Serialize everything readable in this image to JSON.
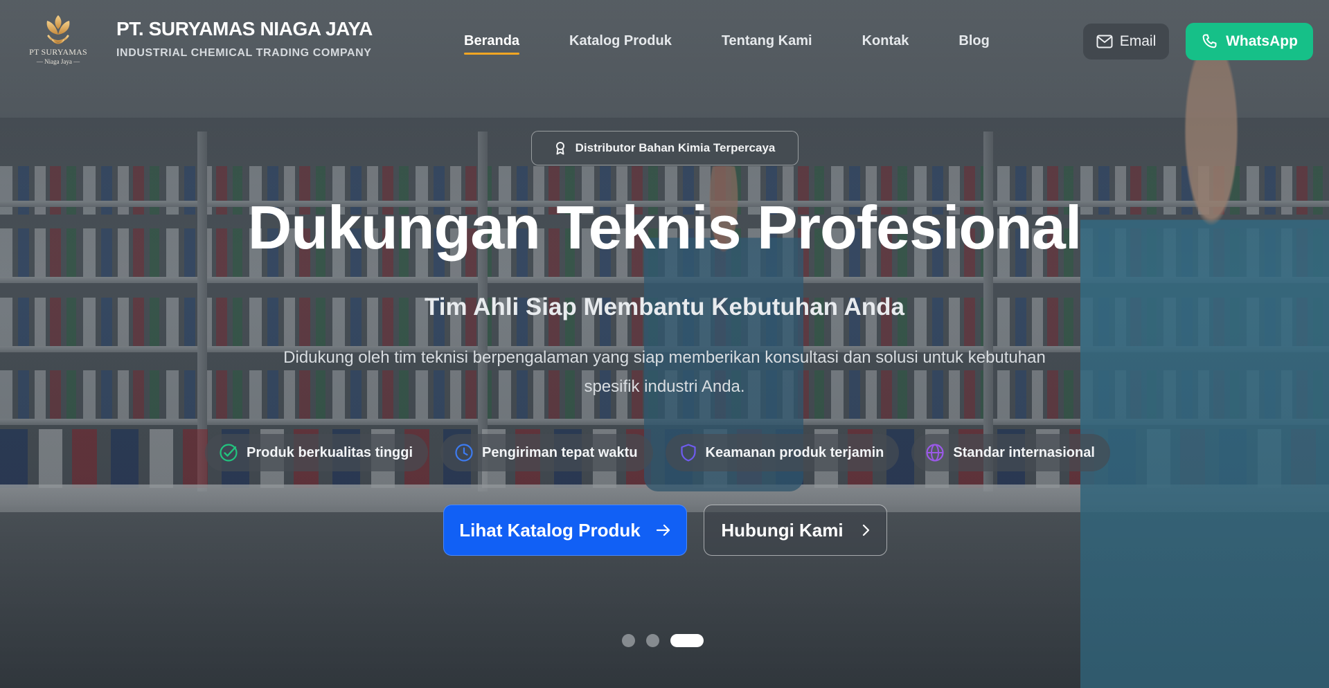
{
  "brand": {
    "logo_line1": "PT SURYAMAS",
    "logo_line2": "— Niaga Jaya —",
    "name": "PT. SURYAMAS NIAGA JAYA",
    "tagline": "INDUSTRIAL CHEMICAL TRADING COMPANY"
  },
  "nav": {
    "items": [
      {
        "label": "Beranda",
        "active": true
      },
      {
        "label": "Katalog Produk",
        "active": false
      },
      {
        "label": "Tentang Kami",
        "active": false
      },
      {
        "label": "Kontak",
        "active": false
      },
      {
        "label": "Blog",
        "active": false
      }
    ]
  },
  "header_actions": {
    "email_label": "Email",
    "whatsapp_label": "WhatsApp"
  },
  "hero": {
    "badge": "Distributor Bahan Kimia Terpercaya",
    "title": "Dukungan Teknis Profesional",
    "subtitle": "Tim Ahli Siap Membantu Kebutuhan Anda",
    "description": "Didukung oleh tim teknisi berpengalaman yang siap memberikan konsultasi dan solusi untuk kebutuhan spesifik industri Anda.",
    "features": [
      {
        "label": "Produk berkualitas tinggi",
        "icon": "check-circle-icon",
        "color": "#22c47f"
      },
      {
        "label": "Pengiriman tepat waktu",
        "icon": "clock-icon",
        "color": "#3d7bf0"
      },
      {
        "label": "Keamanan produk terjamin",
        "icon": "shield-icon",
        "color": "#6f5cf0"
      },
      {
        "label": "Standar internasional",
        "icon": "globe-icon",
        "color": "#9b59e8"
      }
    ],
    "cta_primary": "Lihat Katalog Produk",
    "cta_secondary": "Hubungi Kami"
  },
  "carousel": {
    "slide_count": 3,
    "active_index": 2
  },
  "colors": {
    "accent_underline": "#f5a623",
    "whatsapp": "#16c088",
    "primary_cta": "#1160f5"
  }
}
